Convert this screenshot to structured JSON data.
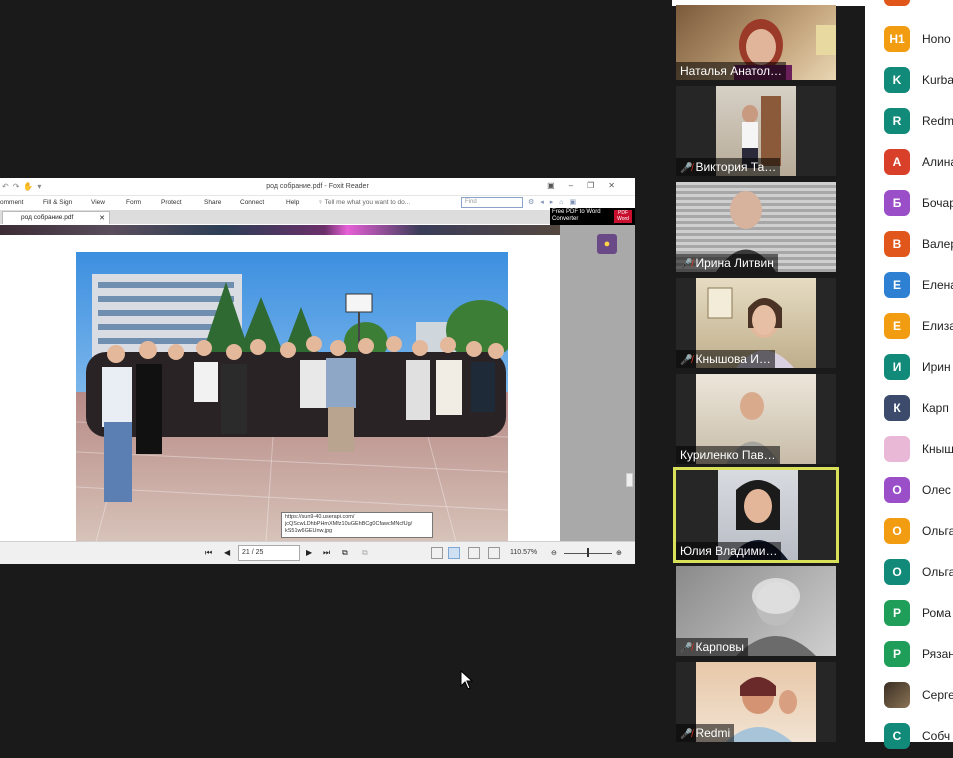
{
  "foxit": {
    "window_title": "род собрание.pdf - Foxit Reader",
    "menu": [
      "omment",
      "Fill & Sign",
      "View",
      "Form",
      "Protect",
      "Share",
      "Connect",
      "Help"
    ],
    "tell_me": "Tell me what you want to do...",
    "find_placeholder": "Find",
    "tab_label": "род собрание.pdf",
    "promo_line1": "Free PDF to Word",
    "promo_line2": "Converter",
    "promo_badge_top": "PDF",
    "promo_badge_bottom": "Word",
    "tooltip": "https://sun9-40.userapi.com/ jcQScwLDhbPHmXMfz10uGEhBCg0CfawcMNcfUg/ kS51w6GEUnw.jpg",
    "page_indicator": "21 / 25",
    "zoom": "110.57%"
  },
  "tiles": [
    {
      "name": "Наталья Анатол…",
      "muted": false
    },
    {
      "name": "Виктория Та…",
      "muted": true
    },
    {
      "name": "Ирина Литвин",
      "muted": true
    },
    {
      "name": "Кнышова И…",
      "muted": true
    },
    {
      "name": "Куриленко Пав…",
      "muted": false
    },
    {
      "name": "Юлия Владими…",
      "muted": false,
      "active": true
    },
    {
      "name": "Карповы",
      "muted": true
    },
    {
      "name": "Redmi",
      "muted": true
    }
  ],
  "participants": [
    {
      "initial": "Н1",
      "name": "Hono",
      "color": "#f29c11"
    },
    {
      "initial": "K",
      "name": "Kurba",
      "color": "#128a7a"
    },
    {
      "initial": "R",
      "name": "Redm",
      "color": "#128a7a"
    },
    {
      "initial": "А",
      "name": "Алина",
      "color": "#d9402a"
    },
    {
      "initial": "Б",
      "name": "Бочар",
      "color": "#9a4fc9"
    },
    {
      "initial": "В",
      "name": "Валер",
      "color": "#e0561b"
    },
    {
      "initial": "Е",
      "name": "Елена",
      "color": "#2d80d2"
    },
    {
      "initial": "Е",
      "name": "Елиза",
      "color": "#f29c11"
    },
    {
      "initial": "И",
      "name": "Ирин",
      "color": "#128a7a"
    },
    {
      "initial": "К",
      "name": "Карп",
      "color": "#3c4a6b"
    },
    {
      "initial": "",
      "name": "Кныш",
      "color": "#e8b8d6"
    },
    {
      "initial": "О",
      "name": "Олес",
      "color": "#9a4fc9"
    },
    {
      "initial": "О",
      "name": "Ольга",
      "color": "#f29c11"
    },
    {
      "initial": "О",
      "name": "Ольга",
      "color": "#128a7a"
    },
    {
      "initial": "Р",
      "name": "Рома",
      "color": "#1f9e5a"
    },
    {
      "initial": "Р",
      "name": "Рязан",
      "color": "#1f9e5a"
    },
    {
      "initial": "",
      "name": "Серге",
      "color": "#6d5a3e"
    },
    {
      "initial": "С",
      "name": "Собч",
      "color": "#128a7a"
    }
  ]
}
